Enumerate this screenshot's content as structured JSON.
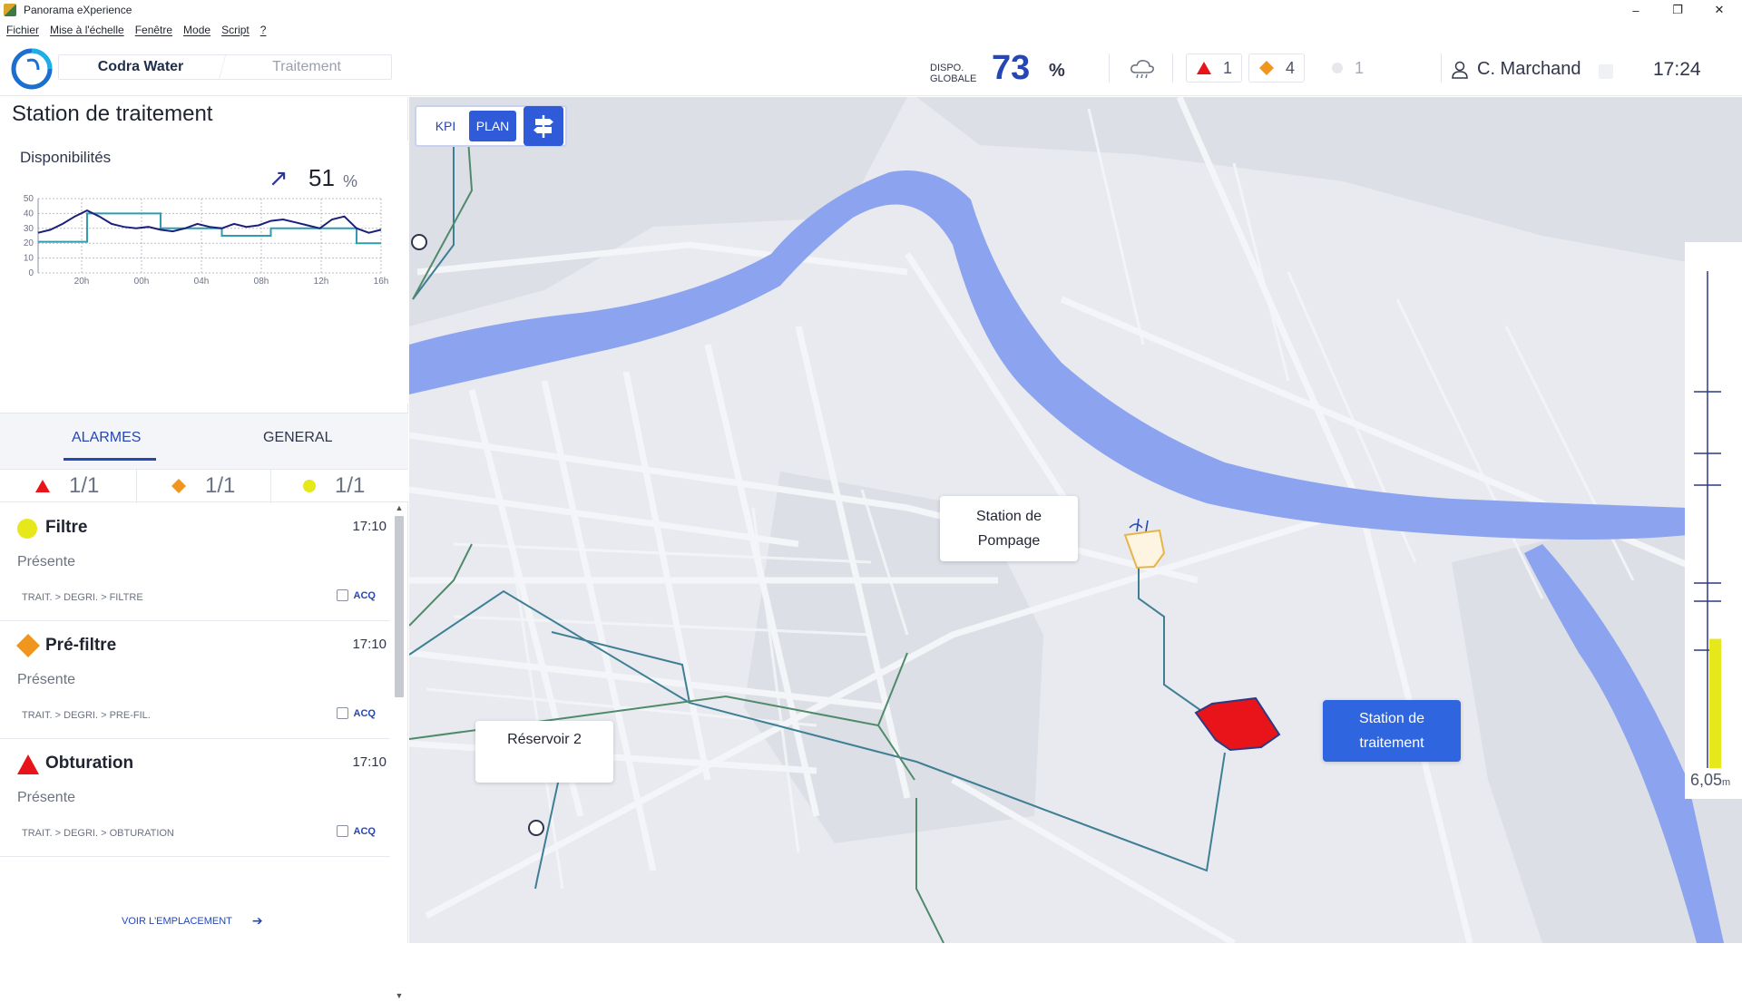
{
  "window": {
    "title": "Panorama eXperience",
    "minimize": "–",
    "maximize": "❐",
    "close": "✕"
  },
  "menu": [
    "Fichier",
    "Mise à l'échelle",
    "Fenêtre",
    "Mode",
    "Script",
    "?"
  ],
  "header": {
    "breadcrumb": [
      "Codra Water",
      "Traitement"
    ],
    "dispo_label_1": "DISPO.",
    "dispo_label_2": "GLOBALE",
    "dispo_value": "73",
    "dispo_unit": "%",
    "weather_icon": "cloud-rain-icon",
    "counts": {
      "red": "1",
      "orange": "4",
      "gray": "1"
    },
    "user": "C. Marchand",
    "time": "17:24"
  },
  "panel": {
    "title": "Station de traitement",
    "dispo_title": "Disponibilités",
    "trend_arrow": "↗",
    "trend_value": "51",
    "trend_unit": "%",
    "tabs": [
      "ALARMES",
      "GENERAL"
    ],
    "severity": [
      {
        "color": "red",
        "count": "1/1"
      },
      {
        "color": "orange",
        "count": "1/1"
      },
      {
        "color": "yellow",
        "count": "1/1"
      }
    ],
    "alarms": [
      {
        "name": "Filtre",
        "time": "17:10",
        "state": "Présente",
        "path": "TRAIT. > DEGRI. > FILTRE",
        "acq": "ACQ",
        "severity": "yellow"
      },
      {
        "name": "Pré-filtre",
        "time": "17:10",
        "state": "Présente",
        "path": "TRAIT. > DEGRI. > PRE-FIL.",
        "acq": "ACQ",
        "severity": "orange"
      },
      {
        "name": "Obturation",
        "time": "17:10",
        "state": "Présente",
        "path": "TRAIT. > DEGRI. > OBTURATION",
        "acq": "ACQ",
        "severity": "red"
      }
    ],
    "voir": "VOIR L'EMPLACEMENT",
    "voir_arrow": "➔"
  },
  "chart_data": {
    "type": "line",
    "title": "",
    "x_ticks": [
      "20h",
      "00h",
      "04h",
      "08h",
      "12h",
      "16h"
    ],
    "y_ticks": [
      "0",
      "10",
      "20",
      "30",
      "40",
      "50"
    ],
    "ylim": [
      0,
      50
    ],
    "grid": true,
    "series": [
      {
        "color": "#1c1f7a",
        "points": [
          [
            0,
            27
          ],
          [
            1,
            29
          ],
          [
            2,
            33
          ],
          [
            3,
            38
          ],
          [
            4,
            42
          ],
          [
            5,
            38
          ],
          [
            6,
            33
          ],
          [
            7,
            31
          ],
          [
            8,
            30
          ],
          [
            9,
            31
          ],
          [
            10,
            29
          ],
          [
            11,
            28
          ],
          [
            12,
            30
          ],
          [
            13,
            33
          ],
          [
            14,
            31
          ],
          [
            15,
            30
          ],
          [
            16,
            33
          ],
          [
            17,
            31
          ],
          [
            18,
            32
          ],
          [
            19,
            35
          ],
          [
            20,
            36
          ],
          [
            21,
            34
          ],
          [
            22,
            32
          ],
          [
            23,
            30
          ],
          [
            24,
            36
          ],
          [
            25,
            38
          ],
          [
            26,
            30
          ],
          [
            27,
            27
          ],
          [
            28,
            29
          ]
        ]
      },
      {
        "color": "#2e9db0",
        "points": [
          [
            0,
            21
          ],
          [
            4,
            21
          ],
          [
            4,
            40
          ],
          [
            10,
            40
          ],
          [
            10,
            30
          ],
          [
            15,
            30
          ],
          [
            15,
            25
          ],
          [
            19,
            25
          ],
          [
            19,
            30
          ],
          [
            26,
            30
          ],
          [
            26,
            20
          ],
          [
            28,
            20
          ]
        ]
      }
    ]
  },
  "map": {
    "mode_kpi": "KPI",
    "mode_plan": "PLAN",
    "nav_icon": "signpost-icon",
    "pump_label": [
      "Station de",
      "Pompage"
    ],
    "treat_label": [
      "Station de",
      "traitement"
    ],
    "reservoir_label": "Réservoir 2",
    "gauge_value": "6,05",
    "gauge_unit": "m",
    "gauge_level": 0.26
  },
  "colors": {
    "accent": "#2547b5",
    "alarm_red": "#e8141a",
    "alarm_orange": "#f0961e",
    "alarm_yellow": "#e6e81c",
    "river": "#8ca4ef"
  }
}
